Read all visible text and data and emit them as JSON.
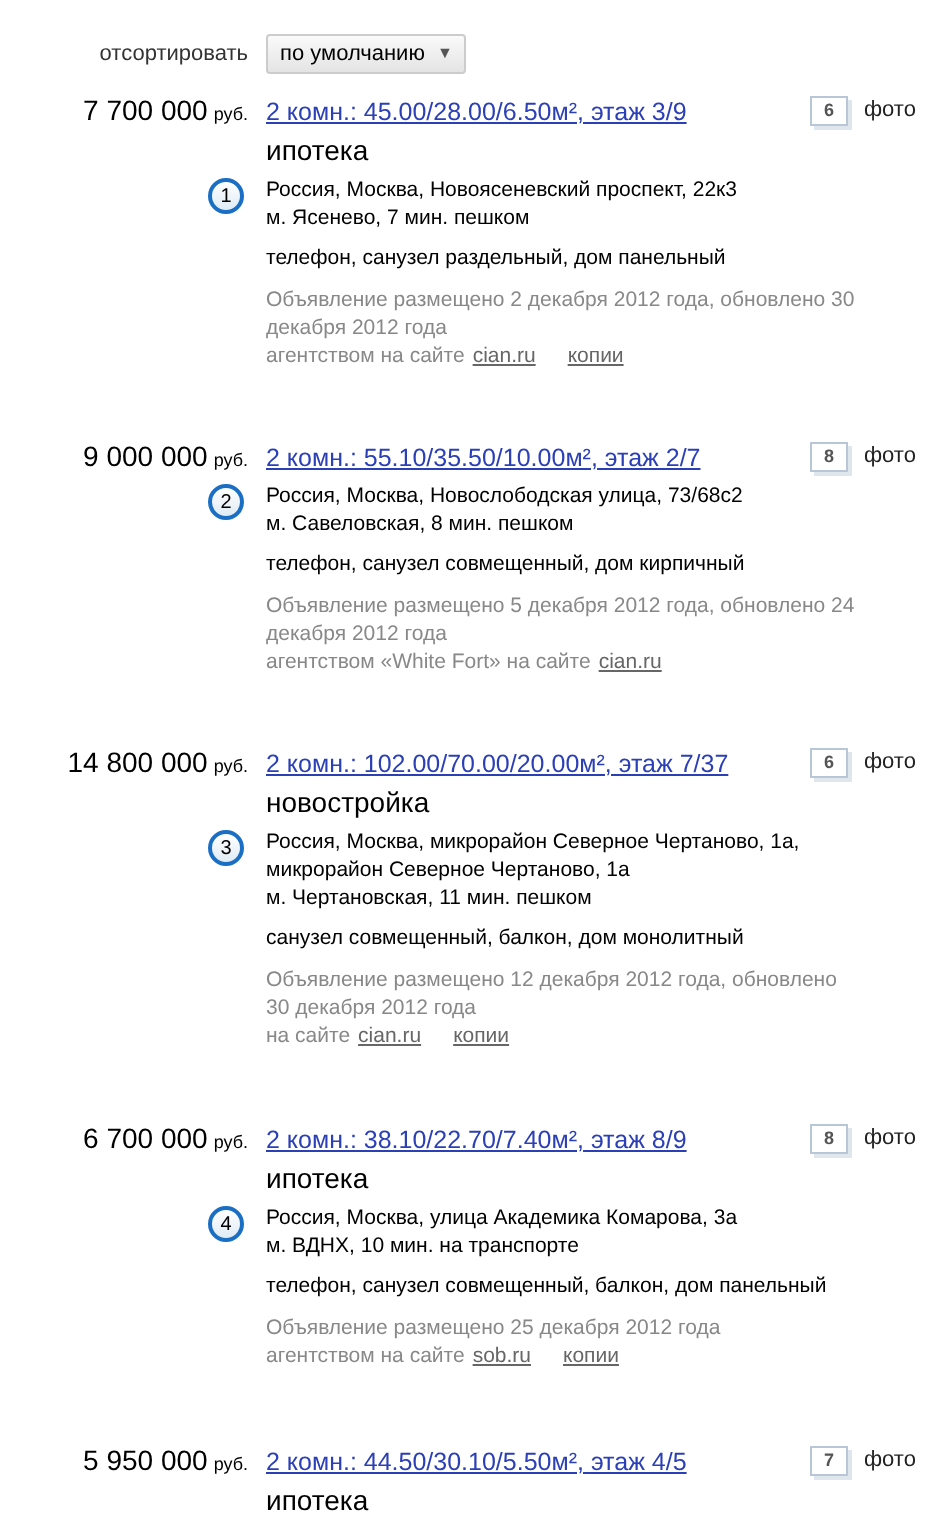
{
  "sort": {
    "label": "отсортировать",
    "value": "по умолчанию",
    "caret": "▼"
  },
  "listings": [
    {
      "price": "7 700 000",
      "currency": "руб.",
      "title": "2 комн.: 45.00/28.00/6.50м², этаж 3/9",
      "photos": "6",
      "photo_label": "фото",
      "tag": "ипотека",
      "number": "1",
      "address": [
        "Россия, Москва, Новоясеневский проспект, 22к3",
        "м. Ясенево, 7 мин. пешком"
      ],
      "features": "телефон, санузел раздельный, дом панельный",
      "posted": "Объявление размещено 2 декабря 2012 года, обновлено 30 декабря 2012 года",
      "source": "агентством на сайте",
      "site": "cian.ru",
      "copies": "копии"
    },
    {
      "price": "9 000 000",
      "currency": "руб.",
      "title": "2 комн.: 55.10/35.50/10.00м², этаж 2/7",
      "photos": "8",
      "photo_label": "фото",
      "number": "2",
      "address": [
        "Россия, Москва, Новослободская улица, 73/68с2",
        "м. Савеловская, 8 мин. пешком"
      ],
      "features": "телефон, санузел совмещенный, дом кирпичный",
      "posted": "Объявление размещено 5 декабря 2012 года, обновлено 24 декабря 2012 года",
      "source": "агентством «White Fort» на сайте",
      "site": "cian.ru"
    },
    {
      "price": "14 800 000",
      "currency": "руб.",
      "title": "2 комн.: 102.00/70.00/20.00м², этаж 7/37",
      "photos": "6",
      "photo_label": "фото",
      "tag": "новостройка",
      "number": "3",
      "address": [
        "Россия, Москва, микрорайон Северное Чертаново, 1а,",
        "микрорайон Северное Чертаново, 1а",
        "м. Чертановская, 11 мин. пешком"
      ],
      "features": "санузел совмещенный, балкон, дом монолитный",
      "posted": "Объявление размещено 12 декабря 2012 года, обновлено 30 декабря 2012 года",
      "source": "на сайте",
      "site": "cian.ru",
      "copies": "копии"
    },
    {
      "price": "6 700 000",
      "currency": "руб.",
      "title": "2 комн.: 38.10/22.70/7.40м², этаж 8/9",
      "photos": "8",
      "photo_label": "фото",
      "tag": "ипотека",
      "number": "4",
      "address": [
        "Россия, Москва, улица Академика Комарова, 3а",
        "м. ВДНХ, 10 мин. на транспорте"
      ],
      "features": "телефон, санузел совмещенный, балкон, дом панельный",
      "posted": "Объявление размещено 25 декабря 2012 года",
      "source": "агентством на сайте",
      "site": "sob.ru",
      "copies": "копии"
    },
    {
      "price": "5 950 000",
      "currency": "руб.",
      "title": "2 комн.: 44.50/30.10/5.50м², этаж 4/5",
      "photos": "7",
      "photo_label": "фото",
      "tag": "ипотека"
    }
  ]
}
